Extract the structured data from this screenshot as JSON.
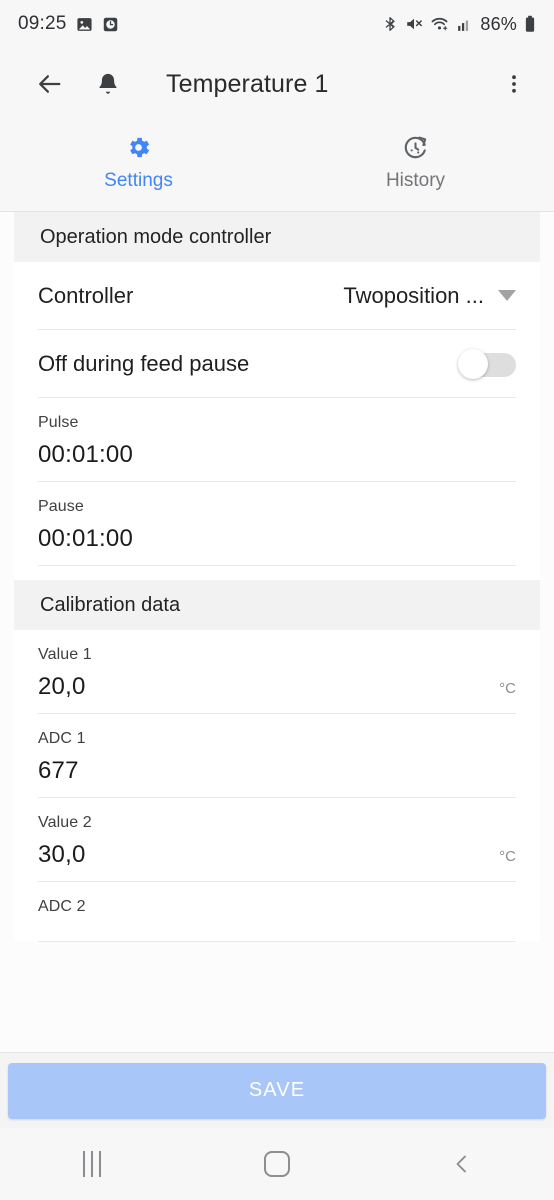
{
  "status_bar": {
    "time": "09:25",
    "battery_percent": "86%",
    "icons": [
      "image-icon",
      "alarm-icon",
      "bluetooth-icon",
      "mute-icon",
      "wifi-icon",
      "cellular-signal-icon",
      "battery-icon"
    ]
  },
  "app_bar": {
    "title": "Temperature 1",
    "back_icon": "arrow-left-icon",
    "bell_icon": "bell-icon",
    "overflow_icon": "more-vertical-icon"
  },
  "tabs": [
    {
      "label": "Settings",
      "icon": "gear-icon",
      "active": true
    },
    {
      "label": "History",
      "icon": "history-timer-icon",
      "active": false
    }
  ],
  "sections": [
    {
      "header": "Operation mode controller",
      "rows": [
        {
          "type": "select",
          "label": "Controller",
          "value": "Twoposition ...",
          "icon": "chevron-down-icon"
        },
        {
          "type": "switch",
          "label": "Off during feed pause",
          "checked": false
        },
        {
          "type": "field",
          "label": "Pulse",
          "value": "00:01:00",
          "unit": ""
        },
        {
          "type": "field",
          "label": "Pause",
          "value": "00:01:00",
          "unit": ""
        }
      ]
    },
    {
      "header": "Calibration data",
      "rows": [
        {
          "type": "field",
          "label": "Value 1",
          "value": "20,0",
          "unit": "°C"
        },
        {
          "type": "field",
          "label": "ADC 1",
          "value": "677",
          "unit": ""
        },
        {
          "type": "field",
          "label": "Value 2",
          "value": "30,0",
          "unit": "°C"
        },
        {
          "type": "field",
          "label": "ADC 2",
          "value": "",
          "unit": ""
        }
      ]
    }
  ],
  "save_bar": {
    "label": "SAVE"
  },
  "nav_bar": {
    "recents_icon": "recents-icon",
    "home_icon": "home-icon",
    "back_icon": "back-chevron-icon"
  },
  "colors": {
    "accent": "#4285f4",
    "save_button": "#a9c6f8",
    "section_header_bg": "#f2f2f2"
  }
}
